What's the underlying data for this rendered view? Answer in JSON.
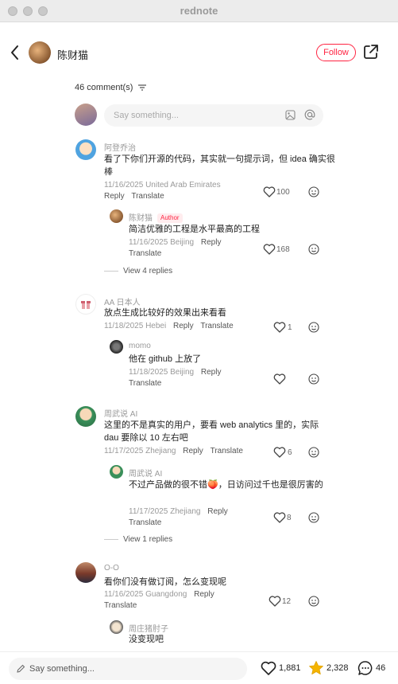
{
  "app": {
    "title": "rednote"
  },
  "header": {
    "author_name": "陈财猫",
    "follow_label": "Follow"
  },
  "comments_section": {
    "count_label": "46 comment(s)",
    "input_placeholder": "Say something..."
  },
  "comments": [
    {
      "name": "阿登乔治",
      "text": "看了下你们开源的代码，其实就一句提示词，但 idea 确实很棒",
      "date": "11/16/2025 United Arab Emirates",
      "reply_label": "Reply",
      "translate_label": "Translate",
      "likes": "100",
      "replies": [
        {
          "name": "陈财猫",
          "author_tag": "Author",
          "text": "简洁优雅的工程是水平最高的工程",
          "date": "11/16/2025 Beijing",
          "reply_label": "Reply",
          "translate_label": "Translate",
          "likes": "168"
        }
      ],
      "view_replies": "View 4 replies"
    },
    {
      "name": "AA 日本人",
      "text": "放点生成比较好的效果出来看看",
      "date": "11/18/2025 Hebei",
      "reply_label": "Reply",
      "translate_label": "Translate",
      "likes": "1",
      "replies": [
        {
          "name": "momo",
          "text": "他在 github 上放了",
          "date": "11/18/2025 Beijing",
          "reply_label": "Reply",
          "translate_label": "Translate",
          "likes": ""
        }
      ]
    },
    {
      "name": "周武说 AI",
      "text": "这里的不是真实的用户，要看 web analytics 里的，实际 dau 要除以 10 左右吧",
      "date": "11/17/2025 Zhejiang",
      "reply_label": "Reply",
      "translate_label": "Translate",
      "likes": "6",
      "replies": [
        {
          "name": "周武说 AI",
          "text": "不过产品做的很不错🍑，日访问过千也是很厉害的",
          "date": "11/17/2025 Zhejiang",
          "reply_label": "Reply",
          "translate_label": "Translate",
          "likes": "8"
        }
      ],
      "view_replies": "View 1 replies"
    },
    {
      "name": "O-O",
      "text": "看你们没有做订阅，怎么变现呢",
      "date": "11/16/2025 Guangdong",
      "reply_label": "Reply",
      "translate_label": "Translate",
      "likes": "12",
      "replies": [
        {
          "name": "周庄猪肘子",
          "text": "没变现吧"
        }
      ]
    }
  ],
  "bottom_bar": {
    "placeholder": "Say something...",
    "likes": "1,881",
    "stars": "2,328",
    "comments": "46"
  },
  "colors": {
    "accent": "#ff2442",
    "star": "#f5b400"
  },
  "icons": [
    "back-icon",
    "share-icon",
    "filter-icon",
    "image-icon",
    "at-icon",
    "heart-icon",
    "reaction-icon",
    "pen-icon",
    "star-icon",
    "comment-icon"
  ]
}
